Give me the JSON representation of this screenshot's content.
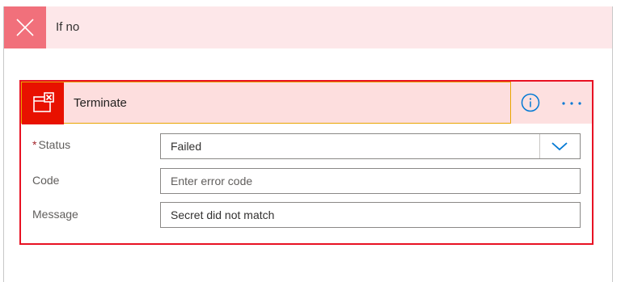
{
  "branch": {
    "title": "If no",
    "icon": "close-icon",
    "accent_color": "#f1707b",
    "header_bg": "#fde7e9"
  },
  "action": {
    "title": "Terminate",
    "icon": "terminate-icon",
    "icon_bg": "#e81100",
    "border_color": "#e81123",
    "info_icon": "info-icon",
    "more_icon": "more-options-icon",
    "fields": {
      "status": {
        "label": "Status",
        "required_marker": "*",
        "value": "Failed",
        "icon": "chevron-down-icon"
      },
      "code": {
        "label": "Code",
        "value": "",
        "placeholder": "Enter error code"
      },
      "message": {
        "label": "Message",
        "value": "Secret did not match"
      }
    }
  }
}
